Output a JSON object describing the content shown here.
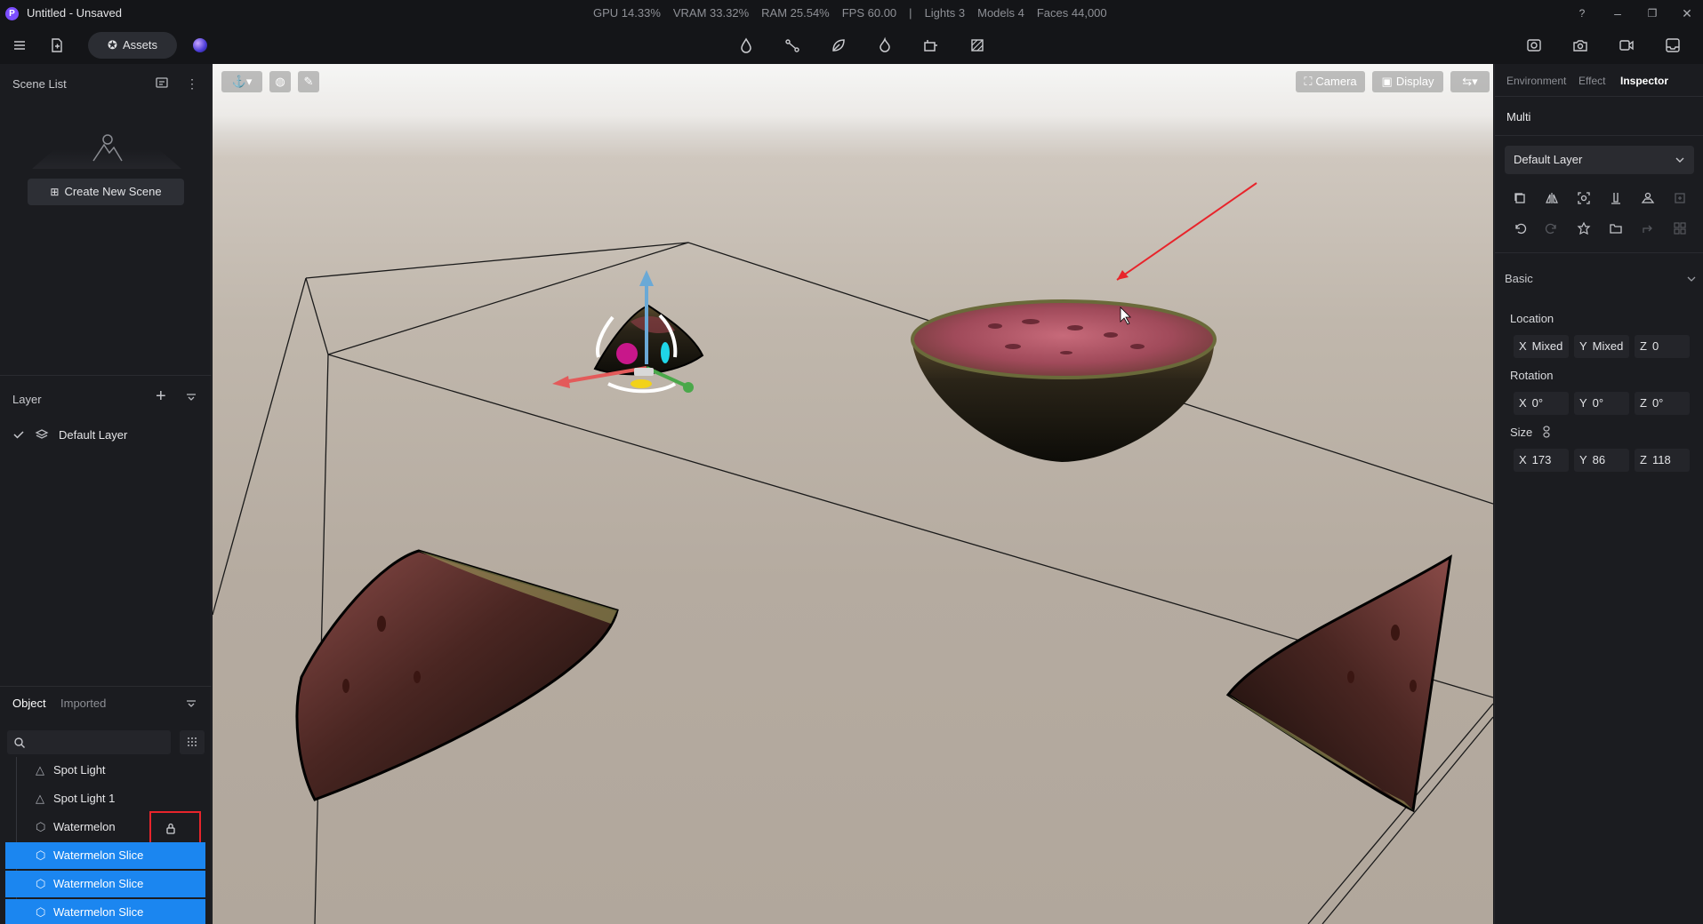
{
  "window": {
    "logo_letter": "P",
    "title": "Untitled - Unsaved",
    "stats": {
      "gpu": "GPU 14.33%",
      "vram": "VRAM 33.32%",
      "ram": "RAM 25.54%",
      "fps": "FPS 60.00",
      "separator": "|",
      "lights": "Lights 3",
      "models": "Models 4",
      "faces": "Faces 44,000"
    },
    "controls": [
      "?",
      "–",
      "❐",
      "✕"
    ]
  },
  "toolbar": {
    "assets_label": "Assets",
    "center_tools": [
      "drop-icon",
      "path-icon",
      "leaf-icon",
      "flame-icon",
      "crop-icon",
      "hatch-icon"
    ],
    "right_tools": [
      "render-icon",
      "camera-icon",
      "video-icon",
      "export-icon"
    ]
  },
  "left_panel": {
    "scene_list": {
      "title": "Scene List",
      "create_label": "Create New Scene"
    },
    "layer": {
      "title": "Layer",
      "items": [
        {
          "name": "Default Layer",
          "checked": true
        }
      ]
    },
    "objects": {
      "tabs": [
        "Object",
        "Imported"
      ],
      "active_tab": "Object",
      "search_placeholder": "",
      "items": [
        {
          "name": "Spot Light",
          "type": "light",
          "selected": false
        },
        {
          "name": "Spot Light 1",
          "type": "light",
          "selected": false
        },
        {
          "name": "Watermelon",
          "type": "model",
          "selected": false,
          "locked": true
        },
        {
          "name": "Watermelon Slice",
          "type": "model",
          "selected": true
        },
        {
          "name": "Watermelon Slice",
          "type": "model",
          "selected": true
        },
        {
          "name": "Watermelon Slice",
          "type": "model",
          "selected": true
        }
      ]
    }
  },
  "viewport": {
    "camera_label": "Camera",
    "display_label": "Display"
  },
  "right_panel": {
    "tabs": [
      "Environment",
      "Effect",
      "Inspector"
    ],
    "active_tab": "Inspector",
    "selection_label": "Multi",
    "layer_select": "Default Layer",
    "section": "Basic",
    "location": {
      "label": "Location",
      "x": "Mixed",
      "y": "Mixed",
      "z": "0"
    },
    "rotation": {
      "label": "Rotation",
      "x": "0°",
      "y": "0°",
      "z": "0°"
    },
    "size": {
      "label": "Size",
      "x": "173",
      "y": "86",
      "z": "118"
    },
    "axis_labels": {
      "x": "X",
      "y": "Y",
      "z": "Z"
    }
  },
  "colors": {
    "selection_blue": "#1b86f0",
    "highlight_red": "#e8242b",
    "brand_purple": "#7b4dff"
  }
}
